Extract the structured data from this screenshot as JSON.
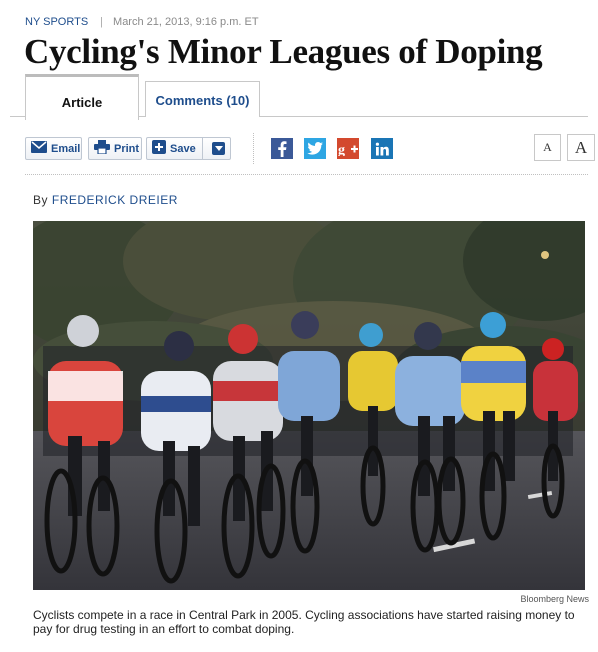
{
  "kicker": {
    "section": "NY SPORTS",
    "separator": "|",
    "date": "March 21, 2013, 9:16 p.m. ET"
  },
  "headline": "Cycling's Minor Leagues of Doping",
  "tabs": [
    {
      "label": "Article",
      "active": true
    },
    {
      "label": "Comments (10)",
      "active": false
    }
  ],
  "toolbar": {
    "email_label": "Email",
    "print_label": "Print",
    "save_label": "Save",
    "share_icons": [
      "facebook-icon",
      "twitter-icon",
      "google-plus-icon",
      "linkedin-icon"
    ],
    "font_small_label": "A",
    "font_large_label": "A"
  },
  "byline": {
    "prefix": "By",
    "author": "FREDERICK DREIER"
  },
  "photo": {
    "credit": "Bloomberg News",
    "caption": "Cyclists compete in a race in Central Park in 2005. Cycling associations have started raising money to pay for drug testing in an effort to combat doping."
  },
  "colors": {
    "link_blue": "#1e4d8c",
    "facebook": "#3b5998",
    "twitter": "#2ea6e3",
    "google_plus": "#d3492e",
    "linkedin": "#1a75b5"
  }
}
